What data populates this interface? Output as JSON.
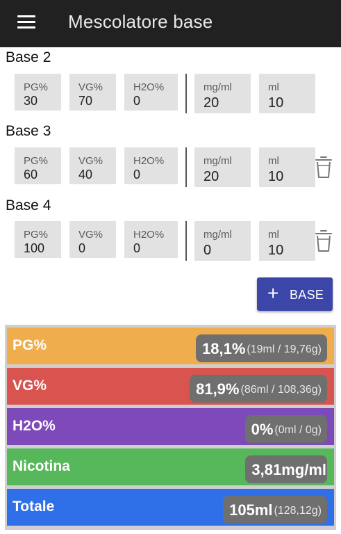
{
  "appbar": {
    "title": "Mescolatore base",
    "menu_icon": "hamburger-icon"
  },
  "bases": [
    {
      "title": "Base 2",
      "pg_label": "PG%",
      "pg": "30",
      "vg_label": "VG%",
      "vg": "70",
      "h2o_label": "H2O%",
      "h2o": "0",
      "nic_label": "mg/ml",
      "nic": "20",
      "ml_label": "ml",
      "ml": "10"
    },
    {
      "title": "Base 3",
      "pg_label": "PG%",
      "pg": "60",
      "vg_label": "VG%",
      "vg": "40",
      "h2o_label": "H2O%",
      "h2o": "0",
      "nic_label": "mg/ml",
      "nic": "20",
      "ml_label": "ml",
      "ml": "10"
    },
    {
      "title": "Base 4",
      "pg_label": "PG%",
      "pg": "100",
      "vg_label": "VG%",
      "vg": "0",
      "h2o_label": "H2O%",
      "h2o": "0",
      "nic_label": "mg/ml",
      "nic": "0",
      "ml_label": "ml",
      "ml": "10"
    }
  ],
  "add_button": {
    "label": "BASE",
    "icon": "plus-icon"
  },
  "summary": {
    "pg": {
      "label": "PG%",
      "main": "18,1%",
      "sub": "(19ml / 19,76g)",
      "color": "#f0ad4e"
    },
    "vg": {
      "label": "VG%",
      "main": "81,9%",
      "sub": "(86ml / 108,36g)",
      "color": "#d9534f"
    },
    "h2o": {
      "label": "H2O%",
      "main": "0%",
      "sub": "(0ml / 0g)",
      "color": "#7e49b8"
    },
    "nic": {
      "label": "Nicotina",
      "main": "3,81mg/ml",
      "sub": "",
      "color": "#56b85a"
    },
    "tot": {
      "label": "Totale",
      "main": "105ml",
      "sub": "(128,12g)",
      "color": "#2f6fe8"
    }
  },
  "colors": {
    "appbar": "#212121",
    "accent": "#3b46a8",
    "field_bg": "#e2e2e2",
    "pill_bg": "#6f6f6f"
  }
}
